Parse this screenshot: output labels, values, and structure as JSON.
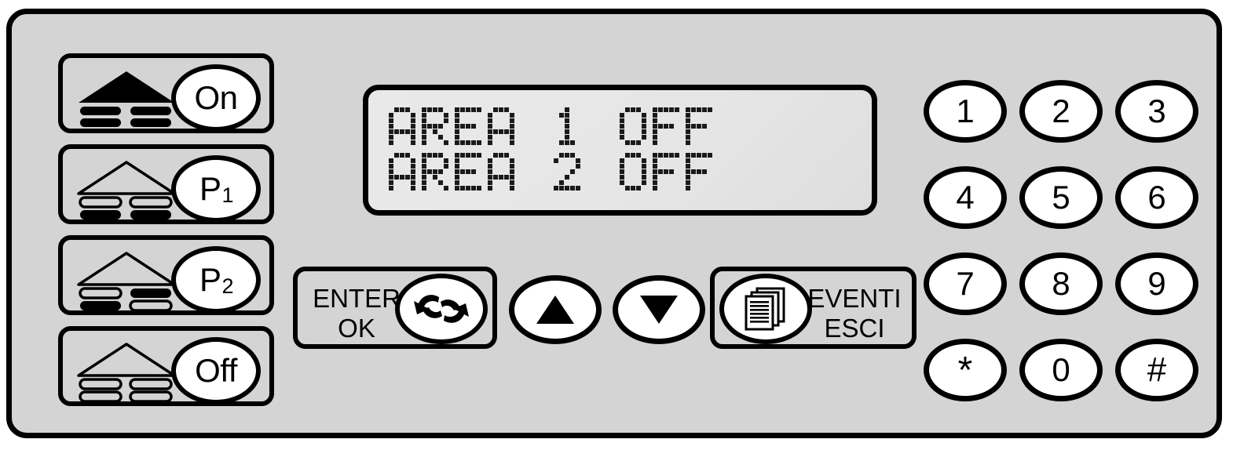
{
  "device": {
    "name": "alarm-keypad",
    "panel_color": "#d4d4d4",
    "border_color": "#000000",
    "key_face_color": "#ffffff"
  },
  "lcd": {
    "background_color": "#e6e6e6",
    "text_color": "#1a1a1a",
    "line1": "AREA 1 OFF",
    "line2": "AREA 2 OFF"
  },
  "mode_buttons": [
    {
      "label": "On",
      "sub": "",
      "icon": "house-armed-full-icon",
      "pattern": "full"
    },
    {
      "label": "P",
      "sub": "1",
      "icon": "house-armed-partial1-icon",
      "pattern": "bottom"
    },
    {
      "label": "P",
      "sub": "2",
      "icon": "house-armed-partial2-icon",
      "pattern": "diagonal"
    },
    {
      "label": "Off",
      "sub": "",
      "icon": "house-disarmed-icon",
      "pattern": "empty"
    }
  ],
  "function_row": {
    "enter": {
      "line1": "ENTER",
      "line2": "OK",
      "icon": "cycle-arrows-icon"
    },
    "arrow_up": {
      "icon": "triangle-up-icon"
    },
    "arrow_down": {
      "icon": "triangle-down-icon"
    },
    "events": {
      "line1": "EVENTI",
      "line2": "ESCI",
      "icon": "documents-stack-icon"
    }
  },
  "keypad": {
    "keys": [
      "1",
      "2",
      "3",
      "4",
      "5",
      "6",
      "7",
      "8",
      "9",
      "*",
      "0",
      "#"
    ]
  }
}
